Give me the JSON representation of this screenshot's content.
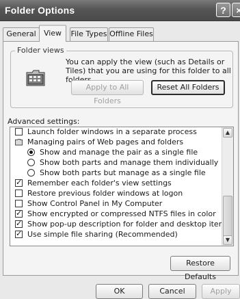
{
  "window": {
    "title": "Folder Options",
    "help_glyph": "?",
    "close_glyph": "×"
  },
  "tabs": [
    {
      "label": "General",
      "active": false
    },
    {
      "label": "View",
      "active": true
    },
    {
      "label": "File Types",
      "active": false
    },
    {
      "label": "Offline Files",
      "active": false
    }
  ],
  "folder_views": {
    "group_label": "Folder views",
    "icon": "folder-details-view-icon",
    "description": "You can apply the view (such as Details or Tiles) that you are using for this folder to all folders.",
    "apply_all_label": "Apply to All Folders",
    "reset_all_label": "Reset All Folders"
  },
  "advanced": {
    "label": "Advanced settings:",
    "items": [
      {
        "type": "checkbox",
        "checked": false,
        "level": 1,
        "label": "Launch folder windows in a separate process"
      },
      {
        "type": "folder",
        "checked": false,
        "level": 1,
        "label": "Managing pairs of Web pages and folders"
      },
      {
        "type": "radio",
        "checked": true,
        "level": 2,
        "label": "Show and manage the pair as a single file"
      },
      {
        "type": "radio",
        "checked": false,
        "level": 2,
        "label": "Show both parts and manage them individually"
      },
      {
        "type": "radio",
        "checked": false,
        "level": 2,
        "label": "Show both parts but manage as a single file"
      },
      {
        "type": "checkbox",
        "checked": true,
        "level": 1,
        "label": "Remember each folder's view settings"
      },
      {
        "type": "checkbox",
        "checked": false,
        "level": 1,
        "label": "Restore previous folder windows at logon"
      },
      {
        "type": "checkbox",
        "checked": false,
        "level": 1,
        "label": "Show Control Panel in My Computer"
      },
      {
        "type": "checkbox",
        "checked": true,
        "level": 1,
        "label": "Show encrypted or compressed NTFS files in color"
      },
      {
        "type": "checkbox",
        "checked": true,
        "level": 1,
        "label": "Show pop-up description for folder and desktop items"
      },
      {
        "type": "checkbox",
        "checked": true,
        "level": 1,
        "label": "Use simple file sharing (Recommended)"
      }
    ],
    "restore_defaults_label": "Restore Defaults"
  },
  "footer": {
    "ok_label": "OK",
    "cancel_label": "Cancel",
    "apply_label": "Apply"
  },
  "colors": {
    "titlebar": "#555555",
    "dialog_bg": "#e9e9e9",
    "panel_bg": "#f4f4f4",
    "list_bg": "#ffffff"
  }
}
